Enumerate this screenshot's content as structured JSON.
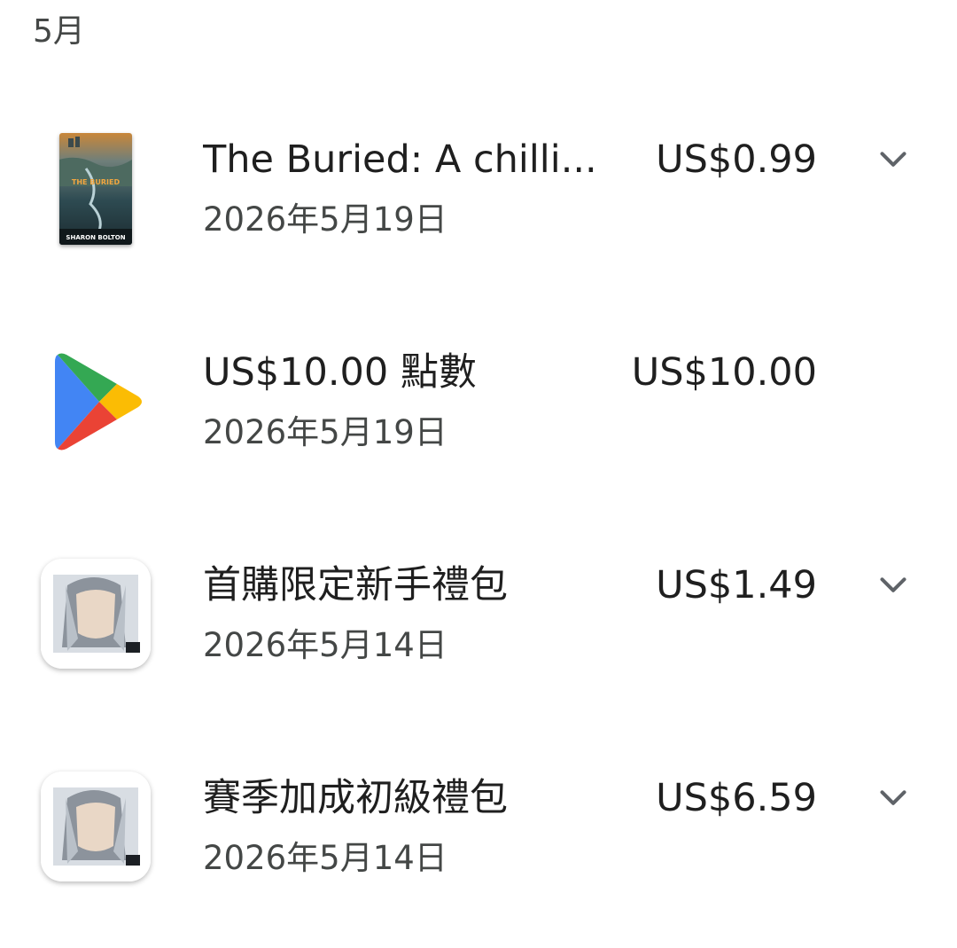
{
  "section": {
    "month": "5月"
  },
  "purchases": [
    {
      "title": "The Buried: A chilli...",
      "date": "2026年5月19日",
      "price": "US$0.99",
      "thumbnail": "book-cover",
      "cover_title": "THE BURIED",
      "cover_author": "SHARON BOLTON",
      "has_chevron": true
    },
    {
      "title": "US$10.00 點數",
      "date": "2026年5月19日",
      "price": "US$10.00",
      "thumbnail": "google-play-icon",
      "has_chevron": false
    },
    {
      "title": "首購限定新手禮包",
      "date": "2026年5月14日",
      "price": "US$1.49",
      "thumbnail": "dissidia-app-icon",
      "has_chevron": true
    },
    {
      "title": "賽季加成初級禮包",
      "date": "2026年5月14日",
      "price": "US$6.59",
      "thumbnail": "dissidia-app-icon",
      "has_chevron": true
    }
  ],
  "colors": {
    "text_primary": "#1f1f1f",
    "text_secondary": "#444746",
    "chevron": "#5f6368",
    "play_blue": "#4285f4",
    "play_green": "#34a853",
    "play_yellow": "#fbbc04",
    "play_red": "#ea4335"
  }
}
